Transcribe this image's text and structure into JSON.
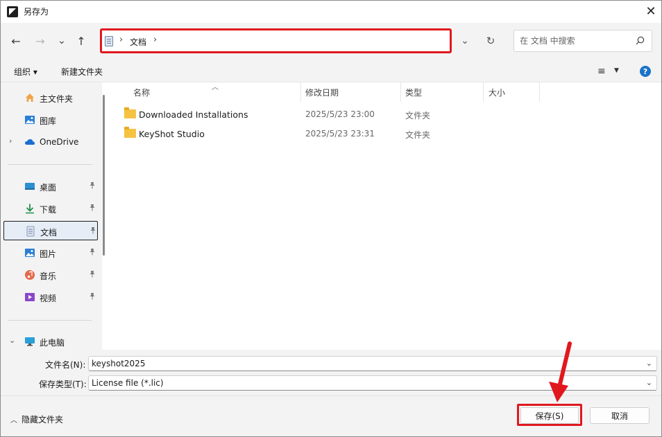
{
  "window": {
    "title": "另存为",
    "close": "✕"
  },
  "nav": {
    "back": "←",
    "forward": "→",
    "recent": "⌄",
    "up": "↑",
    "address": {
      "separator": "›",
      "crumb": "文档"
    },
    "address_dropdown": "⌄",
    "refresh": "↻",
    "search": {
      "placeholder": "在 文档 中搜索"
    }
  },
  "toolbar": {
    "organize": "组织 ▾",
    "new_folder": "新建文件夹",
    "view": "≡",
    "view_dd": "▼",
    "help": "?"
  },
  "sidebar": {
    "items": [
      {
        "label": "主文件夹",
        "icon": "home-icon",
        "pinned": false,
        "expandable": false
      },
      {
        "label": "图库",
        "icon": "gallery-icon",
        "pinned": false,
        "expandable": false
      },
      {
        "label": "OneDrive",
        "icon": "cloud-icon",
        "pinned": false,
        "expandable": true,
        "chevron": "›"
      },
      {
        "label": "桌面",
        "icon": "desktop-icon",
        "pinned": true
      },
      {
        "label": "下载",
        "icon": "download-icon",
        "pinned": true
      },
      {
        "label": "文档",
        "icon": "document-icon",
        "pinned": true,
        "selected": true
      },
      {
        "label": "图片",
        "icon": "pictures-icon",
        "pinned": true
      },
      {
        "label": "音乐",
        "icon": "music-icon",
        "pinned": true
      },
      {
        "label": "视频",
        "icon": "video-icon",
        "pinned": true
      },
      {
        "label": "此电脑",
        "icon": "computer-icon",
        "pinned": false,
        "expandable": true,
        "chevron": "⌄"
      }
    ],
    "pin_glyph": "📌"
  },
  "files": {
    "columns": {
      "name": "名称",
      "modified": "修改日期",
      "type": "类型",
      "size": "大小"
    },
    "sort_glyph": "︿",
    "rows": [
      {
        "name": "Downloaded Installations",
        "modified": "2025/5/23 23:00",
        "type": "文件夹",
        "size": ""
      },
      {
        "name": "KeyShot Studio",
        "modified": "2025/5/23 23:31",
        "type": "文件夹",
        "size": ""
      }
    ]
  },
  "form": {
    "filename_label": "文件名(N):",
    "filename_value": "keyshot2025",
    "filetype_label": "保存类型(T):",
    "filetype_value": "License file (*.lic)",
    "dropdown": "⌄"
  },
  "footer": {
    "hide_folders": "隐藏文件夹",
    "hide_chevron": "︿",
    "save": "保存(S)",
    "cancel": "取消"
  },
  "colors": {
    "highlight": "#e0181e",
    "accent": "#1a72c9",
    "selected_bg": "#e6edf7"
  }
}
